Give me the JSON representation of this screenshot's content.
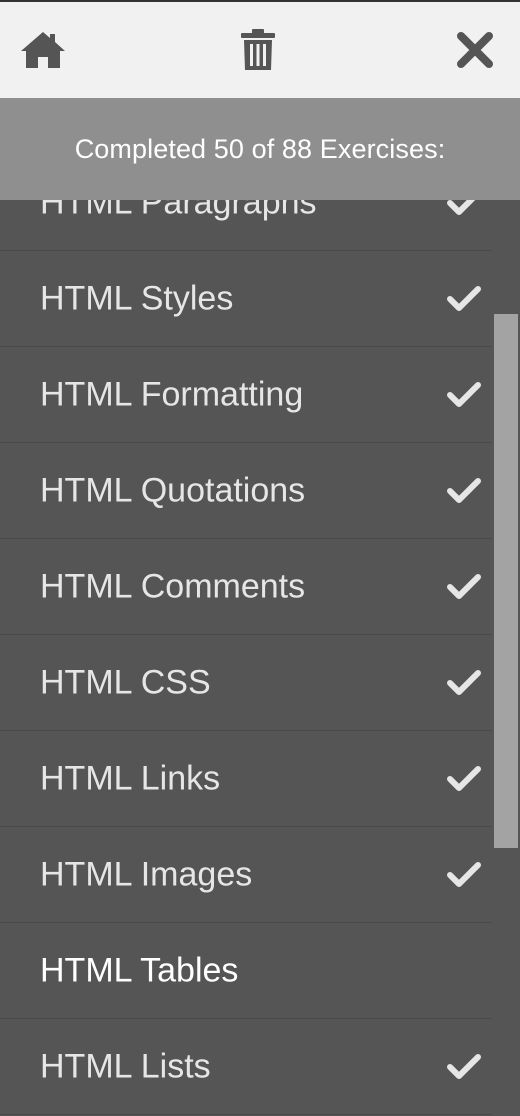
{
  "toolbar": {
    "home_icon": "home-icon",
    "trash_icon": "trash-icon",
    "close_icon": "close-icon"
  },
  "progress": {
    "text": "Completed 50 of 88 Exercises:"
  },
  "exercises": {
    "items": [
      {
        "label": "HTML Paragraphs",
        "completed": true
      },
      {
        "label": "HTML Styles",
        "completed": true
      },
      {
        "label": "HTML Formatting",
        "completed": true
      },
      {
        "label": "HTML Quotations",
        "completed": true
      },
      {
        "label": "HTML Comments",
        "completed": true
      },
      {
        "label": "HTML CSS",
        "completed": true
      },
      {
        "label": "HTML Links",
        "completed": true
      },
      {
        "label": "HTML Images",
        "completed": true
      },
      {
        "label": "HTML Tables",
        "completed": false,
        "current": true
      },
      {
        "label": "HTML Lists",
        "completed": true
      }
    ],
    "check_icon": "checkmark-icon"
  },
  "colors": {
    "toolbar_bg": "#f1f1f1",
    "banner_bg": "#8f8f8f",
    "list_bg": "#555555",
    "icon_gray": "#555555",
    "check_color": "#e6e6e6",
    "scroll_thumb": "#a3a3a3"
  }
}
